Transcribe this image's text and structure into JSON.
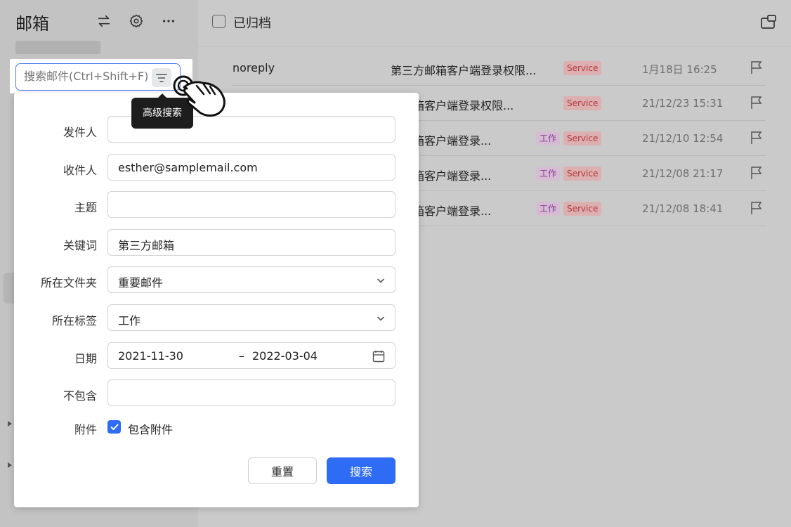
{
  "sidebar": {
    "app_title": "邮箱",
    "search": {
      "placeholder": "搜索邮件(Ctrl+Shift+F)"
    },
    "tooltip": "高级搜索",
    "icons": [
      "swap-icon",
      "gear-icon",
      "more-icon",
      "filter-icon"
    ]
  },
  "main": {
    "header": {
      "title": "已归档"
    },
    "rows": [
      {
        "sender": "noreply",
        "subject": "第三方邮箱客户端登录权限...",
        "tags": [
          "Service"
        ],
        "date": "1月18日 16:25"
      },
      {
        "sender": "",
        "subject": "方邮箱客户端登录权限...",
        "tags": [
          "Service"
        ],
        "date": "21/12/23 15:31"
      },
      {
        "sender": "",
        "subject": "方邮箱客户端登录...",
        "tags": [
          "工作",
          "Service"
        ],
        "date": "21/12/10 12:54"
      },
      {
        "sender": "",
        "subject": "方邮箱客户端登录...",
        "tags": [
          "工作",
          "Service"
        ],
        "date": "21/12/08 21:17"
      },
      {
        "sender": "",
        "subject": "方邮箱客户端登录...",
        "tags": [
          "工作",
          "Service"
        ],
        "date": "21/12/08 18:41"
      }
    ]
  },
  "advanced_search": {
    "labels": {
      "sender": "发件人",
      "recipient": "收件人",
      "subject": "主题",
      "keyword": "关键词",
      "folder": "所在文件夹",
      "tag": "所在标签",
      "date": "日期",
      "exclude": "不包含",
      "attachment": "附件"
    },
    "values": {
      "sender": "",
      "recipient": "esther@samplemail.com",
      "subject": "",
      "keyword": "第三方邮箱",
      "folder": "重要邮件",
      "tag": "工作",
      "date_start": "2021-11-30",
      "date_sep": "–",
      "date_end": "2022-03-04",
      "exclude": "",
      "attachment_checked": true,
      "attachment_label": "包含附件"
    },
    "buttons": {
      "reset": "重置",
      "search": "搜索"
    }
  },
  "colors": {
    "accent": "#2e6cf5",
    "tag_work_bg": "#d6bcd3",
    "tag_service_bg": "#dcb0b0"
  }
}
